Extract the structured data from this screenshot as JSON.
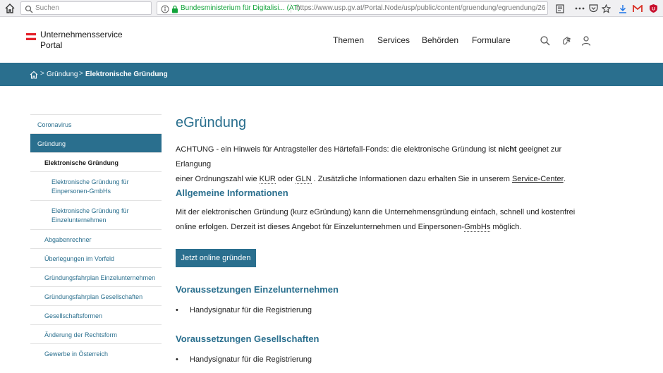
{
  "browser": {
    "search_placeholder": "Suchen",
    "site_identity": "Bundesministerium für Digitalisi... (AT)",
    "url": "https://www.usp.gv.at/Portal.Node/usp/public/content/gruendung/egruendung/26"
  },
  "header": {
    "logo_line1": "Unternehmensservice",
    "logo_line2": "Portal",
    "nav": [
      "Themen",
      "Services",
      "Behörden",
      "Formulare"
    ]
  },
  "breadcrumb": {
    "items": [
      "Gründung",
      "Elektronische Gründung"
    ],
    "separator": ">"
  },
  "sidebar": {
    "items": [
      {
        "label": "Coronavirus"
      },
      {
        "label": "Gründung"
      },
      {
        "label": "Elektronische Gründung"
      },
      {
        "label": "Elektronische Gründung für Einpersonen-GmbHs"
      },
      {
        "label": "Elektronische Gründung für Einzelunternehmen"
      },
      {
        "label": "Abgabenrechner"
      },
      {
        "label": "Überlegungen im Vorfeld"
      },
      {
        "label": "Gründungsfahrplan Einzelunternehmen"
      },
      {
        "label": "Gründungsfahrplan Gesellschaften"
      },
      {
        "label": "Gesellschaftsformen"
      },
      {
        "label": "Änderung der Rechtsform"
      },
      {
        "label": "Gewerbe in Österreich"
      }
    ]
  },
  "main": {
    "title": "eGründung",
    "notice_part1": "ACHTUNG - ein Hinweis für Antragsteller des Härtefall-Fonds: die elektronische Gründung ist ",
    "notice_bold": "nicht",
    "notice_part2": " geeignet zur Erlangung",
    "notice_line2_a": "einer Ordnungszahl wie ",
    "notice_kur": "KUR",
    "notice_oder": " oder ",
    "notice_gln": "GLN",
    "notice_line2_b": " . Zusätzliche Informationen dazu erhalten Sie in unserem ",
    "notice_link": "Service-Center",
    "notice_end": ".",
    "section1_heading": "Allgemeine Informationen",
    "section1_line1": "Mit der elektronischen Gründung (kurz eGründung) kann die Unternehmensgründung einfach, schnell und kostenfrei",
    "section1_line2_a": "online erfolgen. Derzeit ist dieses Angebot für Einzelunternehmen und Einpersonen-",
    "section1_gmbhs": "GmbHs",
    "section1_line2_b": " möglich.",
    "cta_label": "Jetzt online gründen",
    "section2_heading": "Voraussetzungen Einzelunternehmen",
    "section2_bullet": "Handysignatur für die Registrierung",
    "section3_heading": "Voraussetzungen Gesellschaften",
    "section3_bullet": "Handysignatur für die Registrierung",
    "bullet_char": "•"
  },
  "colors": {
    "brand_blue": "#2a6f8e",
    "identity_green": "#12a33a",
    "flag_red": "#e4222b"
  }
}
